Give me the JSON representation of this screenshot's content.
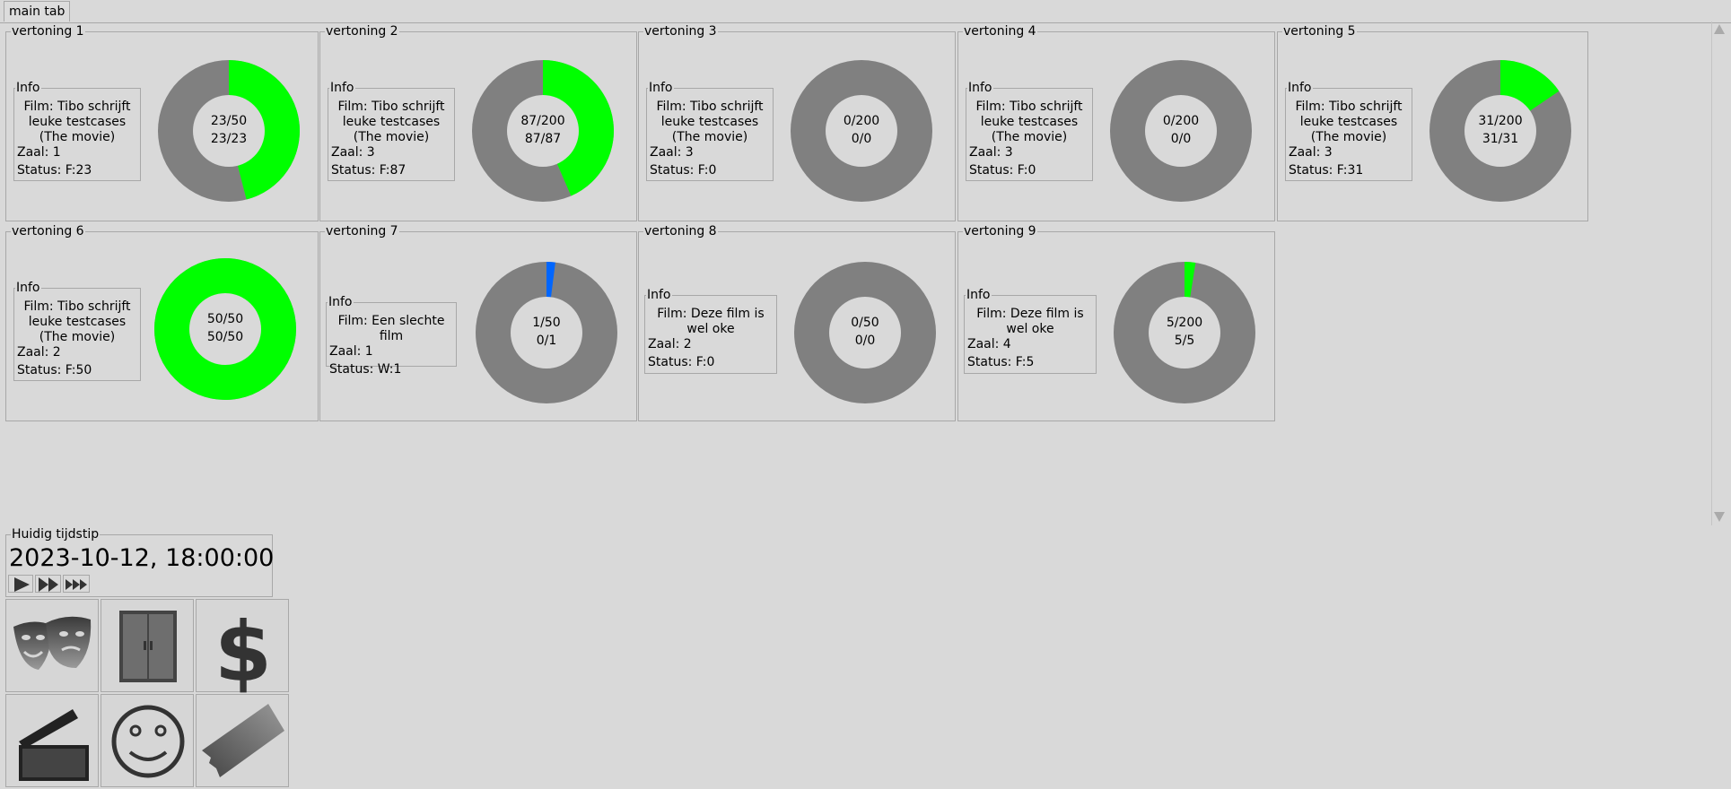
{
  "tabs": [
    {
      "label": "main tab"
    }
  ],
  "screenings": [
    {
      "title": "vertoning 1",
      "info_label": "Info",
      "film": "Film: Tibo schrijft leuke testcases (The movie)",
      "zaal": "Zaal: 1",
      "status": "Status: F:23",
      "line1": "23/50",
      "line2": "23/23",
      "fraction": 0.46,
      "color": "#00ff00"
    },
    {
      "title": "vertoning 2",
      "info_label": "Info",
      "film": "Film: Tibo schrijft leuke testcases (The movie)",
      "zaal": "Zaal: 3",
      "status": "Status: F:87",
      "line1": "87/200",
      "line2": "87/87",
      "fraction": 0.435,
      "color": "#00ff00"
    },
    {
      "title": "vertoning 3",
      "info_label": "Info",
      "film": "Film: Tibo schrijft leuke testcases (The movie)",
      "zaal": "Zaal: 3",
      "status": "Status: F:0",
      "line1": "0/200",
      "line2": "0/0",
      "fraction": 0,
      "color": "#00ff00"
    },
    {
      "title": "vertoning 4",
      "info_label": "Info",
      "film": "Film: Tibo schrijft leuke testcases (The movie)",
      "zaal": "Zaal: 3",
      "status": "Status: F:0",
      "line1": "0/200",
      "line2": "0/0",
      "fraction": 0,
      "color": "#00ff00"
    },
    {
      "title": "vertoning 5",
      "info_label": "Info",
      "film": "Film: Tibo schrijft leuke testcases (The movie)",
      "zaal": "Zaal: 3",
      "status": "Status: F:31",
      "line1": "31/200",
      "line2": "31/31",
      "fraction": 0.155,
      "color": "#00ff00"
    },
    {
      "title": "vertoning 6",
      "info_label": "Info",
      "film": "Film: Tibo schrijft leuke testcases (The movie)",
      "zaal": "Zaal: 2",
      "status": "Status: F:50",
      "line1": "50/50",
      "line2": "50/50",
      "fraction": 1,
      "color": "#00ff00"
    },
    {
      "title": "vertoning 7",
      "info_label": "Info",
      "film": "Film: Een slechte film",
      "zaal": "Zaal: 1",
      "status": "Status: W:1",
      "line1": "1/50",
      "line2": "0/1",
      "fraction": 0.02,
      "color": "#0066ff"
    },
    {
      "title": "vertoning 8",
      "info_label": "Info",
      "film": "Film: Deze film is wel oke",
      "zaal": "Zaal: 2",
      "status": "Status: F:0",
      "line1": "0/50",
      "line2": "0/0",
      "fraction": 0,
      "color": "#00ff00"
    },
    {
      "title": "vertoning 9",
      "info_label": "Info",
      "film": "Film: Deze film is wel oke",
      "zaal": "Zaal: 4",
      "status": "Status: F:5",
      "line1": "5/200",
      "line2": "5/5",
      "fraction": 0.025,
      "color": "#00ff00"
    }
  ],
  "clock": {
    "title": "Huidig tijdstip",
    "value": "2023-10-12, 18:00:00"
  },
  "controls": [
    {
      "name": "play-button",
      "icon": "play-icon"
    },
    {
      "name": "fast-forward-button",
      "icon": "fast-forward-icon"
    },
    {
      "name": "faster-forward-button",
      "icon": "triple-forward-icon"
    }
  ],
  "toolbar": [
    {
      "name": "theater-button",
      "icon": "theater-masks-icon"
    },
    {
      "name": "rooms-button",
      "icon": "door-icon"
    },
    {
      "name": "finance-button",
      "icon": "dollar-icon"
    },
    {
      "name": "films-button",
      "icon": "clapperboard-icon"
    },
    {
      "name": "customers-button",
      "icon": "smiley-icon"
    },
    {
      "name": "tickets-button",
      "icon": "ticket-icon"
    }
  ],
  "colors": {
    "background": "#d9d9d9",
    "ring": "#808080",
    "hole": "#d9d9d9",
    "sold": "#00ff00",
    "waiting": "#0066ff"
  }
}
